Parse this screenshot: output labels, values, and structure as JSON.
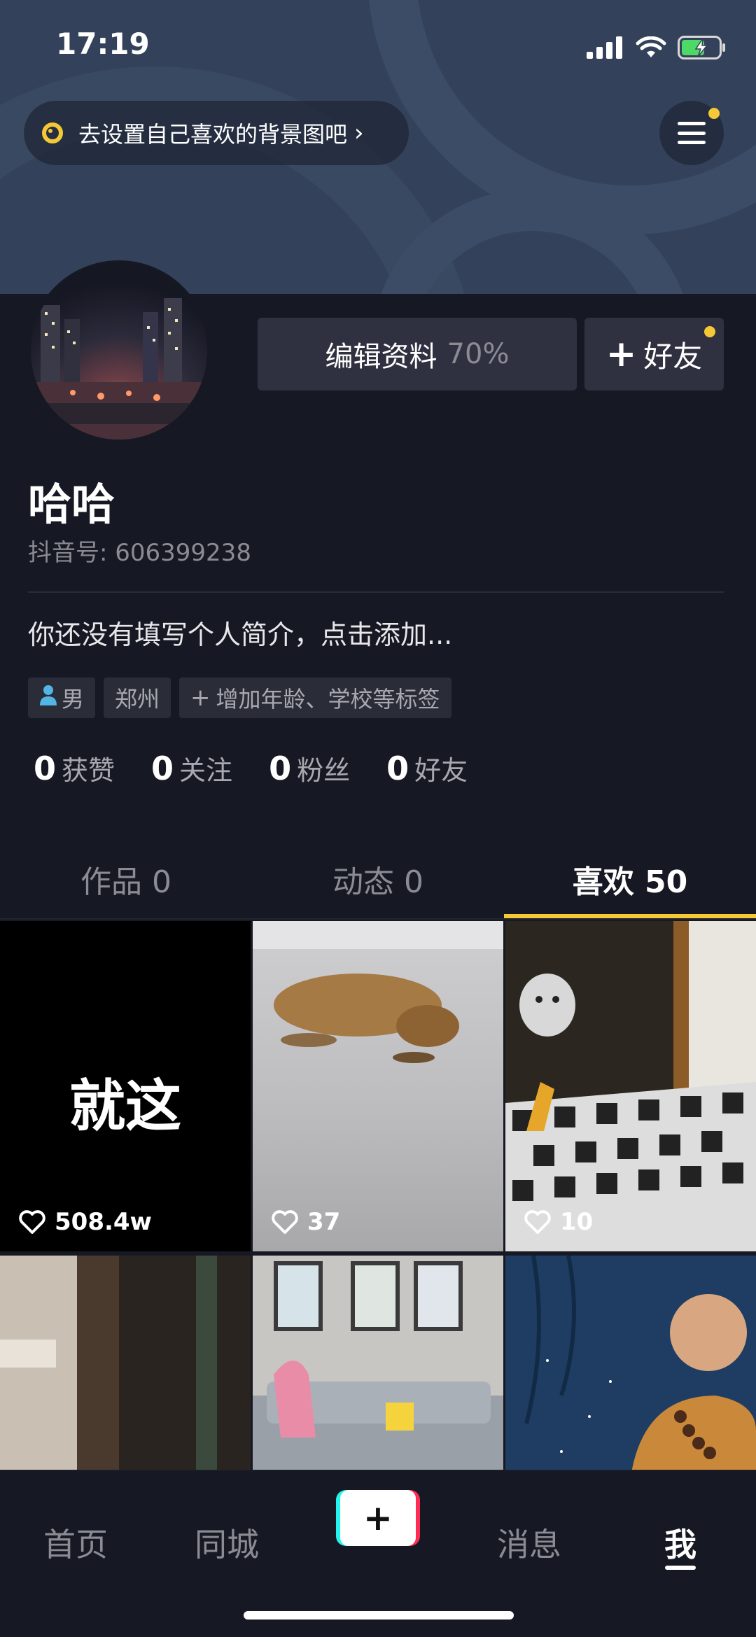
{
  "status_bar": {
    "time": "17:19"
  },
  "header": {
    "background_tip": "去设置自己喜欢的背景图吧",
    "tip_chevron": "›",
    "colors": {
      "accent": "#f5c835",
      "header_bg": "#33425a"
    }
  },
  "profile": {
    "edit_label": "编辑资料",
    "edit_percent": "70%",
    "add_friend_plus": "+",
    "add_friend_label": "好友",
    "username": "哈哈",
    "douyin_id": "抖音号: 606399238",
    "bio": "你还没有填写个人简介，点击添加...",
    "tags": {
      "gender": "男",
      "city": "郑州",
      "add_plus": "+",
      "add_label": "增加年龄、学校等标签"
    },
    "stats": [
      {
        "value": "0",
        "label": "获赞"
      },
      {
        "value": "0",
        "label": "关注"
      },
      {
        "value": "0",
        "label": "粉丝"
      },
      {
        "value": "0",
        "label": "好友"
      }
    ]
  },
  "tabs": [
    {
      "label": "作品 0"
    },
    {
      "label": "动态 0"
    },
    {
      "label": "喜欢 50"
    }
  ],
  "grid": {
    "items": [
      {
        "caption": "就这",
        "likes": "508.4w"
      },
      {
        "likes": "37"
      },
      {
        "likes": "10"
      }
    ]
  },
  "bottom_nav": {
    "items": [
      {
        "label": "首页"
      },
      {
        "label": "同城"
      },
      {
        "label": "+"
      },
      {
        "label": "消息"
      },
      {
        "label": "我"
      }
    ]
  }
}
